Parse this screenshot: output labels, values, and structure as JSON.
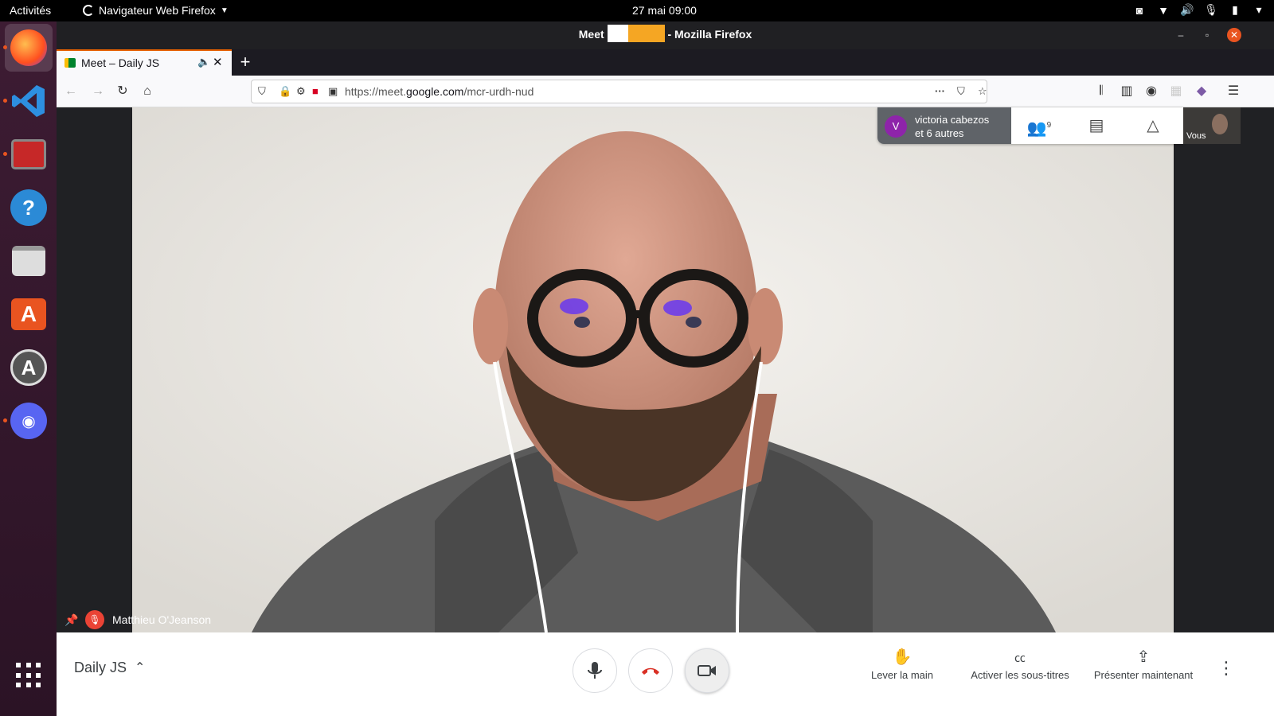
{
  "topbar": {
    "activities": "Activités",
    "app_menu": "Navigateur Web Firefox",
    "clock": "27 mai  09:00"
  },
  "window": {
    "title_left": "Meet",
    "title_right": "- Mozilla Firefox"
  },
  "tab": {
    "label": "Meet – Daily JS",
    "new_tab": "+"
  },
  "url": {
    "prefix": "https://meet.",
    "domain": "google.com",
    "path": "/mcr-urdh-nud"
  },
  "meet": {
    "participant_initial": "V",
    "participant_line1": "victoria cabezos",
    "participant_line2": "et 6 autres",
    "participant_count": "9",
    "self_label": "Vous",
    "speaker_name": "Matthieu O'Jeanson",
    "meeting_name": "Daily JS",
    "actions": {
      "raise_hand": "Lever la main",
      "captions": "Activer les sous-titres",
      "present": "Présenter maintenant"
    }
  },
  "colors": {
    "dock_bg": "#3d1c33",
    "ubuntu_orange": "#e95420",
    "meet_red": "#ea4335",
    "avatar_purple": "#8e24aa"
  }
}
